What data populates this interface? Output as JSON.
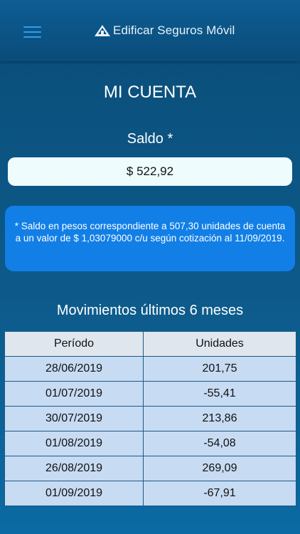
{
  "header": {
    "app_title": "Edificar Seguros Móvil",
    "logo_icon": "building-logo-icon",
    "menu_icon": "hamburger-menu-icon"
  },
  "page": {
    "title": "MI CUENTA"
  },
  "saldo": {
    "label": "Saldo *",
    "value": "$ 522,92"
  },
  "info": {
    "text": "* Saldo en pesos correspondiente a 507,30 unidades de cuenta a un valor de $ 1,03079000 c/u según cotización al 11/09/2019."
  },
  "movimientos": {
    "title": "Movimientos últimos 6 meses",
    "columns": [
      "Período",
      "Unidades"
    ],
    "rows": [
      {
        "periodo": "28/06/2019",
        "unidades": "201,75"
      },
      {
        "periodo": "01/07/2019",
        "unidades": "-55,41"
      },
      {
        "periodo": "30/07/2019",
        "unidades": "213,86"
      },
      {
        "periodo": "01/08/2019",
        "unidades": "-54,08"
      },
      {
        "periodo": "26/08/2019",
        "unidades": "269,09"
      },
      {
        "periodo": "01/09/2019",
        "unidades": "-67,91"
      }
    ]
  },
  "colors": {
    "header_bg": "#0a4c7a",
    "menu_icon": "#2e9ff2",
    "info_box": "#127fe6",
    "saldo_box": "#eefcfd",
    "table_header": "#dfe6ee",
    "table_row": "#c7dbf3"
  }
}
